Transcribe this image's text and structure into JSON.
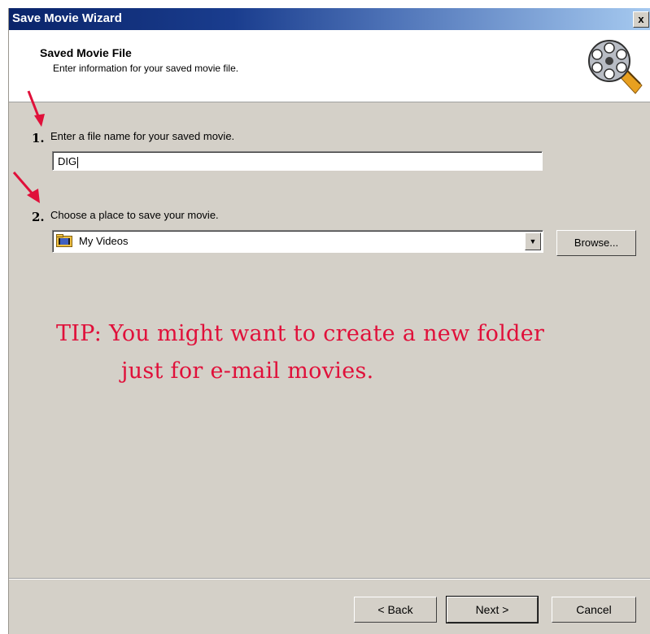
{
  "window": {
    "title": "Save Movie Wizard",
    "close_glyph": "x"
  },
  "header": {
    "title": "Saved Movie File",
    "subtitle": "Enter information for your saved movie file.",
    "icon": "film-reel-icon"
  },
  "step1": {
    "number": "1.",
    "label": "Enter a file name for your saved movie.",
    "value": "DIG"
  },
  "step2": {
    "number": "2.",
    "label": "Choose a place to save your movie.",
    "selected": "My Videos",
    "browse_label": "Browse..."
  },
  "tip": {
    "line1": "TIP: You might want to create a new folder",
    "line2": "just for e-mail movies."
  },
  "buttons": {
    "back": "< Back",
    "next": "Next >",
    "cancel": "Cancel"
  },
  "colors": {
    "annotation_red": "#e0103a",
    "title_bar": "#0a246a",
    "dialog_face": "#d4d0c8"
  }
}
